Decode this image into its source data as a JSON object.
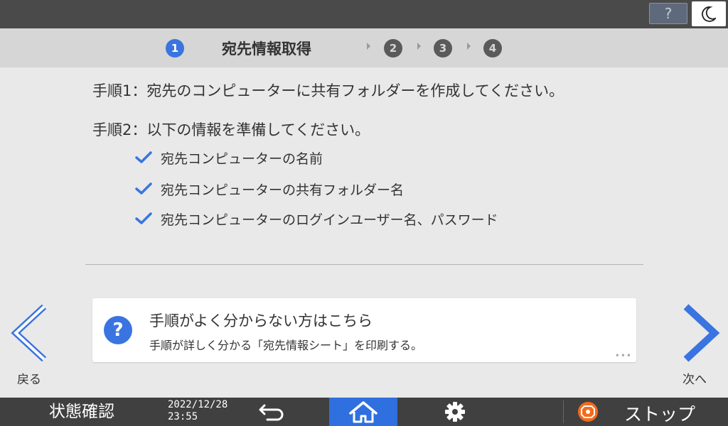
{
  "topbar": {
    "help_label": "?",
    "icons": {
      "help": "question-icon",
      "sleep": "moon-icon"
    }
  },
  "stepper": {
    "steps": [
      "1",
      "2",
      "3",
      "4"
    ],
    "active_step": 1,
    "active_title": "宛先情報取得",
    "colors": {
      "active": "#3a74e0",
      "inactive": "#5a5a5a"
    }
  },
  "content": {
    "step1": "手順1：宛先のコンピューターに共有フォルダーを作成してください。",
    "step2": "手順2：以下の情報を準備してください。",
    "checklist": [
      "宛先コンピューターの名前",
      "宛先コンピューターの共有フォルダー名",
      "宛先コンピューターのログインユーザー名、パスワード"
    ]
  },
  "help_card": {
    "icon_label": "?",
    "title": "手順がよく分からない方はこちら",
    "subtitle": "手順が詳しく分かる「宛先情報シート」を印刷する。",
    "more": "•••"
  },
  "nav": {
    "back_label": "戻る",
    "next_label": "次へ"
  },
  "bottombar": {
    "status_label": "状態確認",
    "date": "2022/12/28",
    "time": "23:55",
    "stop_label": "ストップ",
    "icons": {
      "back": "return-arrow-icon",
      "home": "home-icon",
      "settings": "gear-icon",
      "stop": "stop-icon"
    },
    "colors": {
      "home_active": "#2f6fdf",
      "stop": "#f36b1c"
    }
  }
}
